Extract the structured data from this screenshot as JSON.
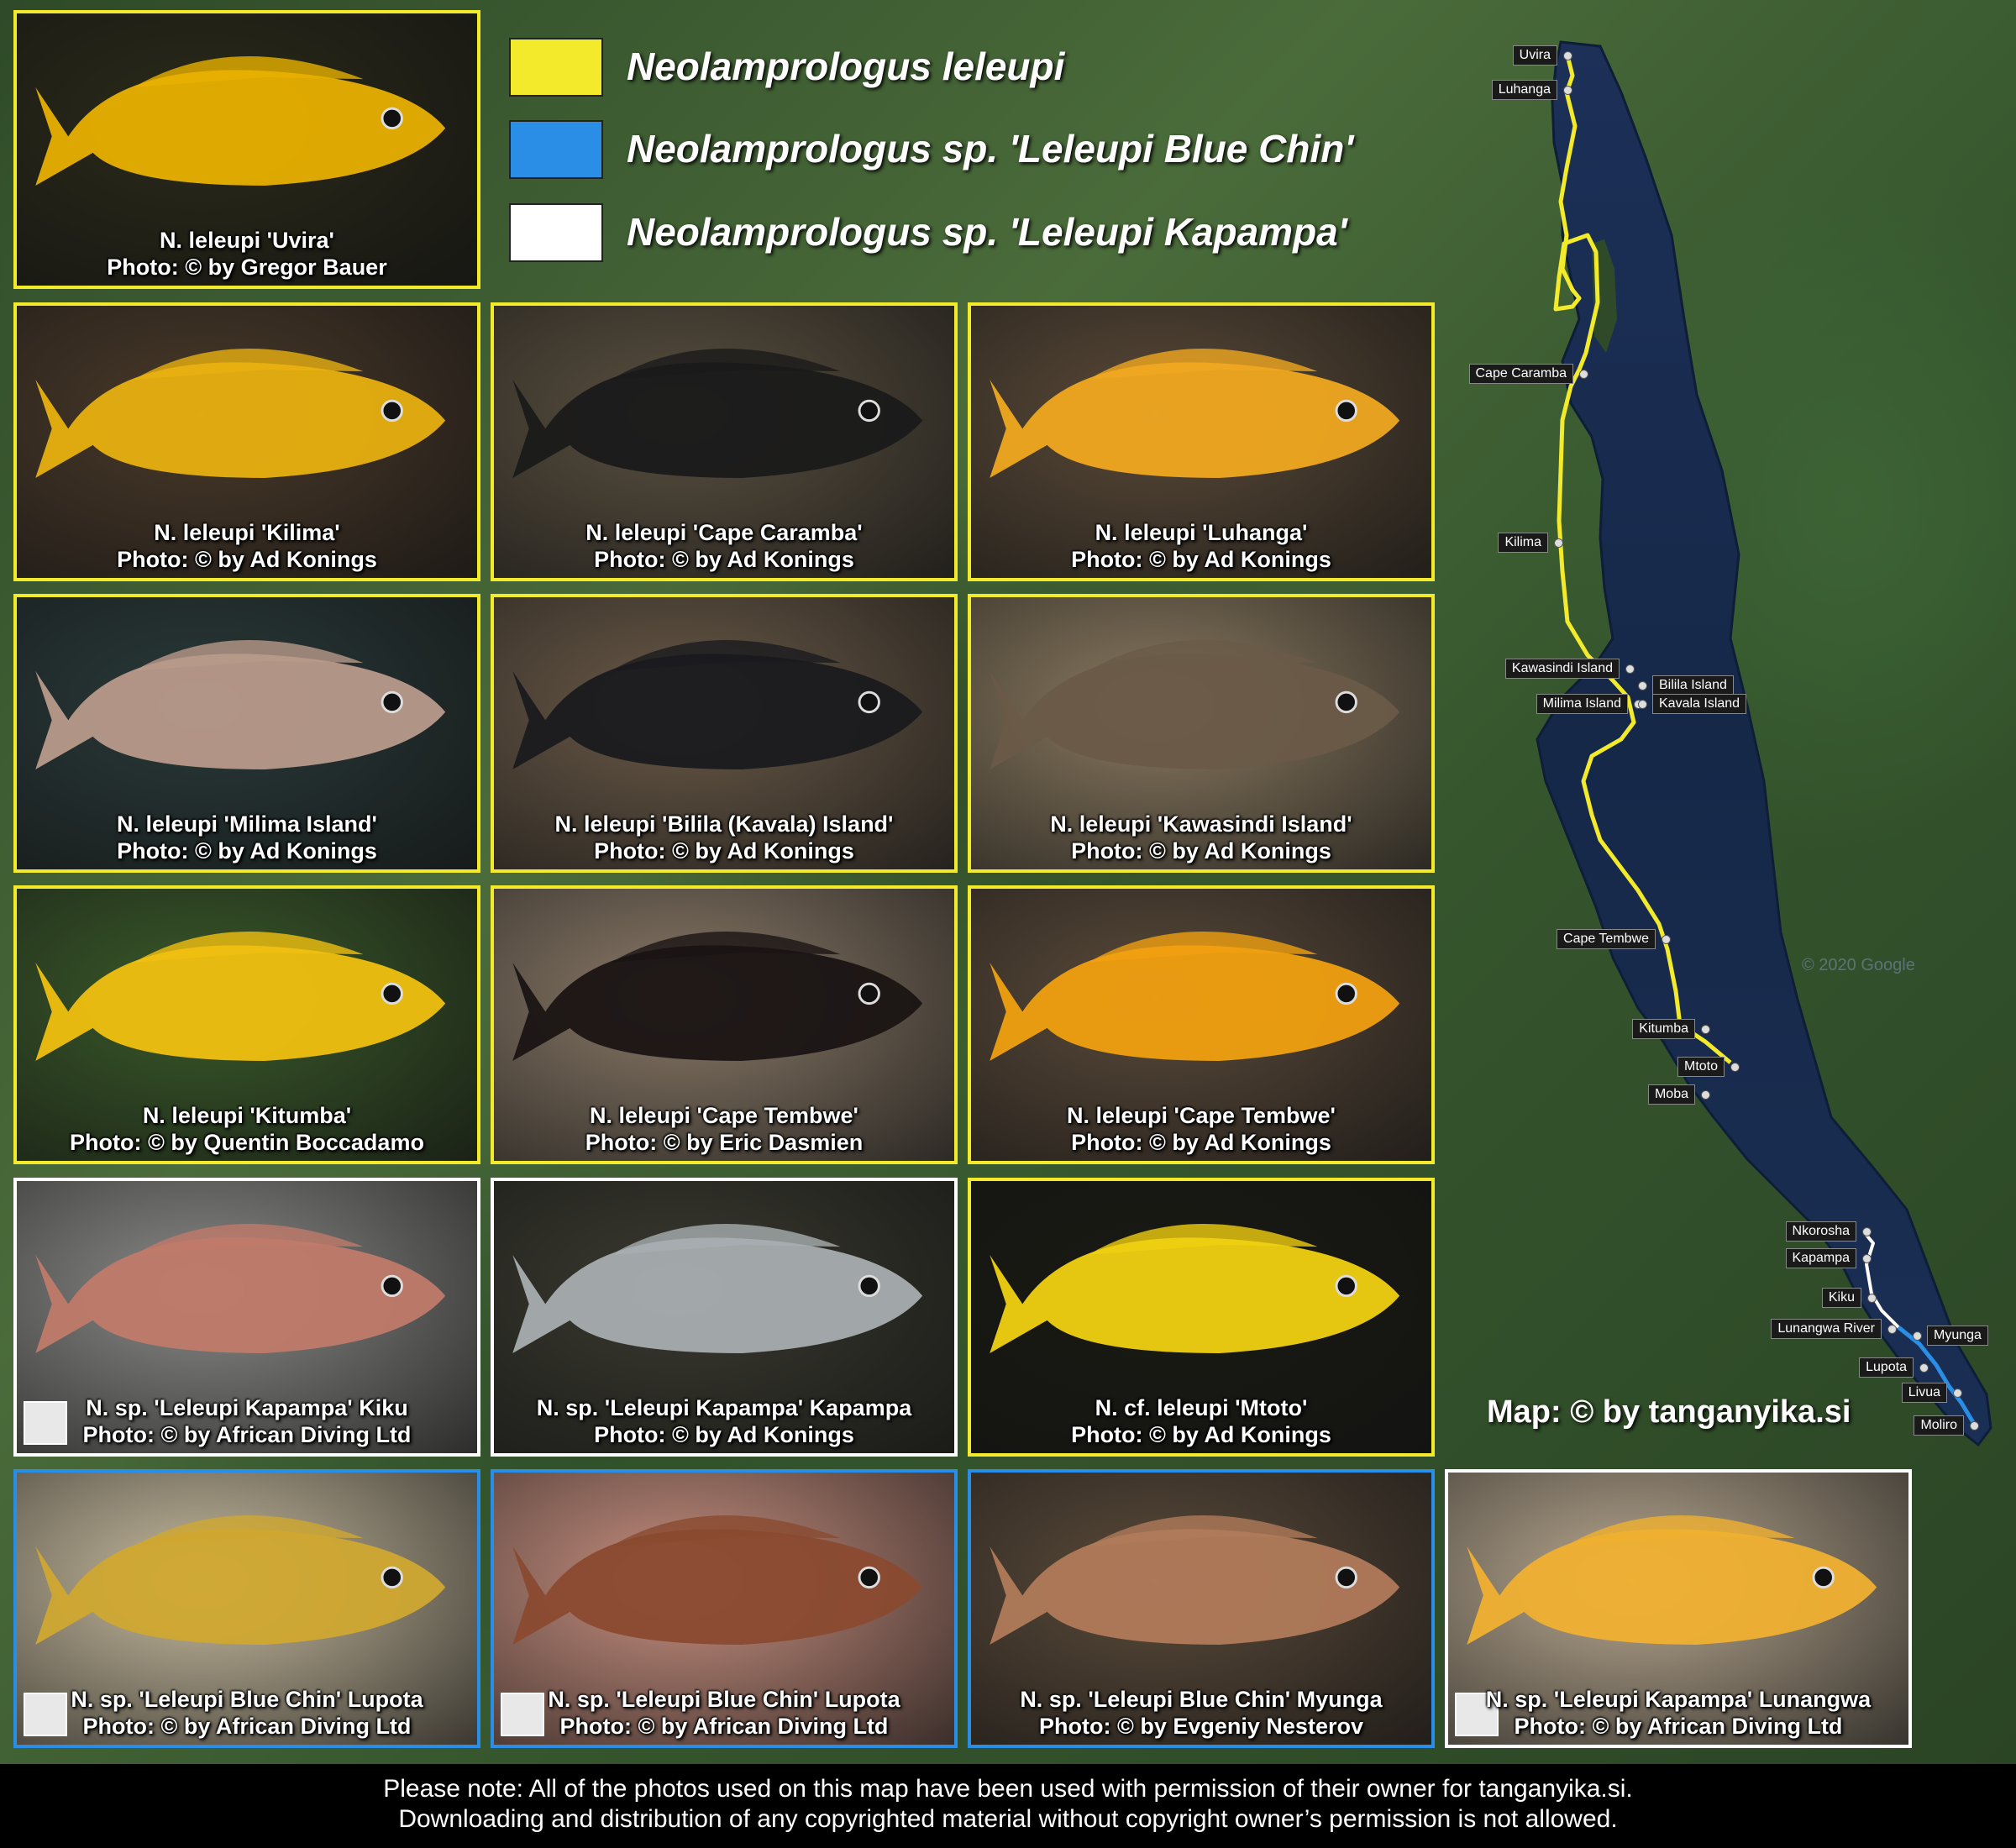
{
  "legend": [
    {
      "label": "Neolamprologus leleupi",
      "color": "#f2ea2a"
    },
    {
      "label": "Neolamprologus sp. 'Leleupi Blue Chin'",
      "color": "#2a8ee6"
    },
    {
      "label": "Neolamprologus sp. 'Leleupi Kapampa'",
      "color": "#ffffff"
    }
  ],
  "photos": [
    {
      "title": "N. leleupi 'Uvira'",
      "credit": "Photo: © by Gregor Bauer",
      "group": "yellow",
      "fish": "#e8b000",
      "bg": "#2a2a1a"
    },
    {
      "title": "N. leleupi 'Kilima'",
      "credit": "Photo: © by Ad Konings",
      "group": "yellow",
      "fish": "#e8b010",
      "bg": "#4a3a2a"
    },
    {
      "title": "N. leleupi 'Cape Caramba'",
      "credit": "Photo: © by Ad Konings",
      "group": "yellow",
      "fish": "#1a1a1a",
      "bg": "#5a5040"
    },
    {
      "title": "N. leleupi 'Luhanga'",
      "credit": "Photo: © by Ad Konings",
      "group": "yellow",
      "fish": "#f0a820",
      "bg": "#5a4a38"
    },
    {
      "title": "N. leleupi 'Milima Island'",
      "credit": "Photo: © by Ad Konings",
      "group": "yellow",
      "fish": "#b89a8a",
      "bg": "#2a3a3a"
    },
    {
      "title": "N. leleupi 'Bilila (Kavala) Island'",
      "credit": "Photo: © by Ad Konings",
      "group": "yellow",
      "fish": "#1a1a1e",
      "bg": "#6a5a48"
    },
    {
      "title": "N. leleupi 'Kawasindi Island'",
      "credit": "Photo: © by Ad Konings",
      "group": "yellow",
      "fish": "#6a5a48",
      "bg": "#8a7a60"
    },
    {
      "title": "N. leleupi 'Kitumba'",
      "credit": "Photo: © by Quentin Boccadamo",
      "group": "yellow",
      "fish": "#f0c010",
      "bg": "#3a5a2a"
    },
    {
      "title": "N. leleupi 'Cape Tembwe'",
      "credit": "Photo: © by Eric Dasmien",
      "group": "yellow",
      "fish": "#1a1414",
      "bg": "#8a7a68"
    },
    {
      "title": "N. leleupi 'Cape Tembwe'",
      "credit": "Photo: © by Ad Konings",
      "group": "yellow",
      "fish": "#f0a010",
      "bg": "#5a4a3a"
    },
    {
      "title": "N. sp. 'Leleupi Kapampa' Kiku",
      "credit": "Photo: © by African Diving Ltd",
      "group": "white",
      "fish": "#c07a6a",
      "bg": "#8a8a88",
      "logo": true
    },
    {
      "title": "N. sp. 'Leleupi Kapampa' Kapampa",
      "credit": "Photo: © by Ad Konings",
      "group": "white",
      "fish": "#a8aeb0",
      "bg": "#3a3a30"
    },
    {
      "title": "N. cf. leleupi 'Mtoto'",
      "credit": "Photo: © by Ad Konings",
      "group": "yellow",
      "fish": "#f0d010",
      "bg": "#1a1a14"
    },
    {
      "title": "N. sp. 'Leleupi Blue Chin' Lupota",
      "credit": "Photo: © by African Diving Ltd",
      "group": "blue",
      "fish": "#d0a830",
      "bg": "#c8bca0",
      "logo": true
    },
    {
      "title": "N. sp. 'Leleupi Blue Chin' Lupota",
      "credit": "Photo: © by African Diving Ltd",
      "group": "blue",
      "fish": "#8a4a30",
      "bg": "#c89080",
      "logo": true
    },
    {
      "title": "N. sp. 'Leleupi Blue Chin' Myunga",
      "credit": "Photo: © by Evgeniy Nesterov",
      "group": "blue",
      "fish": "#b07a5a",
      "bg": "#5a4a3a"
    },
    {
      "title": "N. sp. 'Leleupi Kapampa' Lunangwa",
      "credit": "Photo: © by African Diving Ltd",
      "group": "white",
      "fish": "#f0b030",
      "bg": "#b8a890",
      "logo": true
    }
  ],
  "locations": [
    {
      "name": "Uvira",
      "side": "left"
    },
    {
      "name": "Luhanga",
      "side": "left"
    },
    {
      "name": "Cape Caramba",
      "side": "left"
    },
    {
      "name": "Kilima",
      "side": "left"
    },
    {
      "name": "Kawasindi Island",
      "side": "left"
    },
    {
      "name": "Milima Island",
      "side": "left"
    },
    {
      "name": "Bilila Island",
      "side": "right"
    },
    {
      "name": "Kavala Island",
      "side": "right"
    },
    {
      "name": "Cape Tembwe",
      "side": "left"
    },
    {
      "name": "Kitumba",
      "side": "left"
    },
    {
      "name": "Mtoto",
      "side": "left"
    },
    {
      "name": "Moba",
      "side": "left"
    },
    {
      "name": "Nkorosha",
      "side": "left"
    },
    {
      "name": "Kapampa",
      "side": "left"
    },
    {
      "name": "Kiku",
      "side": "left"
    },
    {
      "name": "Lunangwa River",
      "side": "left"
    },
    {
      "name": "Myunga",
      "side": "right"
    },
    {
      "name": "Lupota",
      "side": "left"
    },
    {
      "name": "Livua",
      "side": "left"
    },
    {
      "name": "Moliro",
      "side": "left"
    }
  ],
  "map_credit": "Map: © by tanganyika.si",
  "watermark": "© 2020 Google",
  "footer": {
    "line1": "Please note: All of the photos used on this map have been used with permission of their owner for tanganyika.si.",
    "line2": "Downloading and distribution of any copyrighted material without copyright owner’s permission is not allowed."
  }
}
